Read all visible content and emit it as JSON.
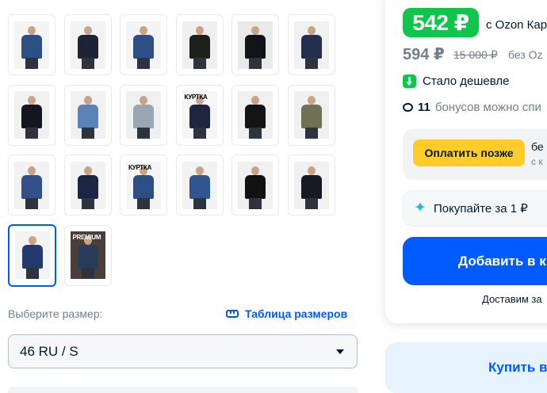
{
  "gallery": {
    "thumbnails": [
      {
        "jacket": "#2c4f84",
        "bg": "#f4f4f4",
        "tag": ""
      },
      {
        "jacket": "#1d2436",
        "bg": "#f3f3f3",
        "tag": ""
      },
      {
        "jacket": "#2d4f86",
        "bg": "#f4f4f4",
        "tag": ""
      },
      {
        "jacket": "#1b2018",
        "bg": "#efefef",
        "tag": ""
      },
      {
        "jacket": "#121419",
        "bg": "#e9e9e9",
        "tag": ""
      },
      {
        "jacket": "#22304d",
        "bg": "#f1f1f1",
        "tag": ""
      },
      {
        "jacket": "#14171f",
        "bg": "#f1f1f1",
        "tag": ""
      },
      {
        "jacket": "#5b83b6",
        "bg": "#f1f1f1",
        "tag": ""
      },
      {
        "jacket": "#9aa6b1",
        "bg": "#f0f0f0",
        "tag": ""
      },
      {
        "jacket": "#1d2540",
        "bg": "#f5f5f5",
        "tag": "КУРТКА"
      },
      {
        "jacket": "#141414",
        "bg": "#f0f0f0",
        "tag": ""
      },
      {
        "jacket": "#6e7155",
        "bg": "#f0f0f0",
        "tag": ""
      },
      {
        "jacket": "#34508a",
        "bg": "#f2f2f2",
        "tag": ""
      },
      {
        "jacket": "#1b2644",
        "bg": "#f2f2f2",
        "tag": ""
      },
      {
        "jacket": "#2d4f86",
        "bg": "#f5f5f5",
        "tag": "КУРТКА"
      },
      {
        "jacket": "#31558f",
        "bg": "#f2f2f2",
        "tag": ""
      },
      {
        "jacket": "#121212",
        "bg": "#f0f0f0",
        "tag": ""
      },
      {
        "jacket": "#161a24",
        "bg": "#f0f0f0",
        "tag": ""
      },
      {
        "jacket": "#223a6e",
        "bg": "#f3f3f3",
        "tag": ""
      },
      {
        "jacket": "#2a3c5c",
        "bg": "#4a3e38",
        "tag": "PREMIUM"
      }
    ],
    "selected_index": 18
  },
  "size": {
    "label": "Выберите размер:",
    "table_link": "Таблица размеров",
    "selected": "46 RU / S"
  },
  "price": {
    "current": "542 ₽",
    "card_label": "с Ozon Кар",
    "old": "594 ₽",
    "crossed": "15 000 ₽",
    "without_card": "без Oz",
    "cheaper": "Стало дешевле",
    "bonus_count": "11",
    "bonus_text": "бонусов можно спи"
  },
  "actions": {
    "pay_later": "Оплатить позже",
    "pay_later_side1": "бе",
    "pay_later_side2": "с к",
    "buy_for_one": "Покупайте за 1 ₽",
    "add_to_cart": "Добавить в к",
    "delivery": "Доставим за",
    "buy_now": "Купить в"
  },
  "colors": {
    "accent": "#005bff",
    "price_green": "#10c44c",
    "pay_later_yellow": "#ffcc29"
  }
}
